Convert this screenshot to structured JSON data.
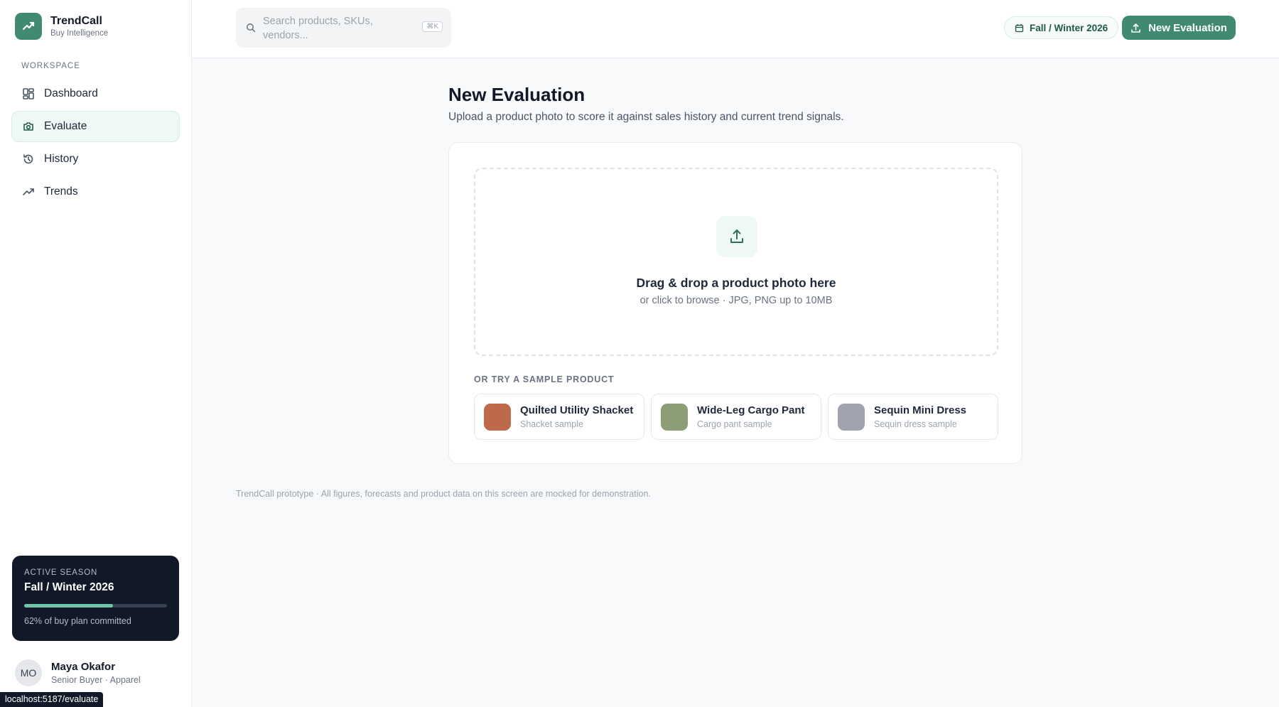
{
  "brand": {
    "name": "TrendCall",
    "subtitle": "Buy Intelligence"
  },
  "sidebar": {
    "section_label": "WORKSPACE",
    "items": [
      {
        "label": "Dashboard",
        "icon": "grid-icon",
        "active": false
      },
      {
        "label": "Evaluate",
        "icon": "camera-icon",
        "active": true
      },
      {
        "label": "History",
        "icon": "history-icon",
        "active": false
      },
      {
        "label": "Trends",
        "icon": "trend-icon",
        "active": false
      }
    ]
  },
  "season_card": {
    "label": "ACTIVE SEASON",
    "name": "Fall / Winter 2026",
    "progress_fraction": 0.62,
    "note": "62% of buy plan committed"
  },
  "user": {
    "initials": "MO",
    "name": "Maya Okafor",
    "role": "Senior Buyer · Apparel"
  },
  "status_url": "localhost:5187/evaluate",
  "topbar": {
    "search_placeholder": "Search products, SKUs, vendors...",
    "shortcut": "⌘K",
    "season_pill": "Fall / Winter 2026",
    "new_button": "New Evaluation"
  },
  "main": {
    "title": "New Evaluation",
    "subtitle": "Upload a product photo to score it against sales history and current trend signals.",
    "dropzone": {
      "title": "Drag & drop a product photo here",
      "subtitle": "or click to browse · JPG, PNG up to 10MB"
    },
    "samples_label": "OR TRY A SAMPLE PRODUCT",
    "samples": [
      {
        "name": "Quilted Utility Shacket",
        "desc": "Shacket sample",
        "color": "#bd6a4a"
      },
      {
        "name": "Wide-Leg Cargo Pant",
        "desc": "Cargo pant sample",
        "color": "#8c9e76"
      },
      {
        "name": "Sequin Mini Dress",
        "desc": "Sequin dress sample",
        "color": "#a0a4ae"
      }
    ],
    "footer_note": "TrendCall prototype · All figures, forecasts and product data on this screen are mocked for demonstration."
  },
  "colors": {
    "accent": "#3f8a70",
    "dark_card": "#111827",
    "progress": "#6ec4a6"
  }
}
